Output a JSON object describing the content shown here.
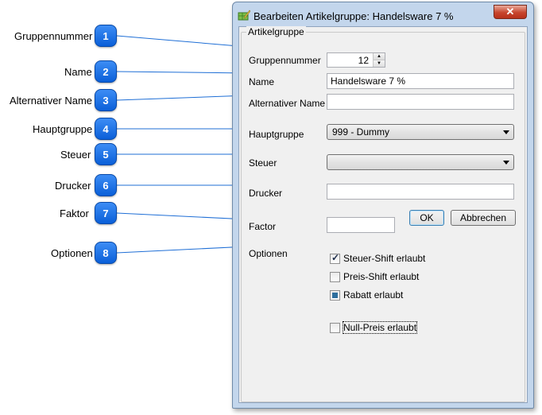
{
  "window": {
    "title": "Bearbeiten Artikelgruppe: Handelsware 7 %",
    "close_glyph": "✕",
    "icon": "edit-table-icon"
  },
  "callouts": [
    {
      "number": "1",
      "label": "Gruppennummer"
    },
    {
      "number": "2",
      "label": "Name"
    },
    {
      "number": "3",
      "label": "Alternativer Name"
    },
    {
      "number": "4",
      "label": "Hauptgruppe"
    },
    {
      "number": "5",
      "label": "Steuer"
    },
    {
      "number": "6",
      "label": "Drucker"
    },
    {
      "number": "7",
      "label": "Faktor"
    },
    {
      "number": "8",
      "label": "Optionen"
    }
  ],
  "form": {
    "group_title": "Artikelgruppe",
    "gruppennummer": {
      "label": "Gruppennummer",
      "value": "12"
    },
    "name": {
      "label": "Name",
      "value": "Handelsware 7 %"
    },
    "alt_name": {
      "label": "Alternativer Name",
      "value": ""
    },
    "hauptgruppe": {
      "label": "Hauptgruppe",
      "value": "999 - Dummy"
    },
    "steuer": {
      "label": "Steuer",
      "value": ""
    },
    "drucker": {
      "label": "Drucker",
      "value": ""
    },
    "factor": {
      "label": "Factor",
      "value": ""
    },
    "optionen_label": "Optionen",
    "options": [
      {
        "label": "Steuer-Shift erlaubt",
        "state": "checked"
      },
      {
        "label": "Preis-Shift erlaubt",
        "state": "unchecked"
      },
      {
        "label": "Rabatt erlaubt",
        "state": "indeterminate"
      },
      {
        "label": "Null-Preis erlaubt",
        "state": "unchecked"
      }
    ]
  },
  "buttons": {
    "ok": "OK",
    "cancel": "Abbrechen"
  }
}
